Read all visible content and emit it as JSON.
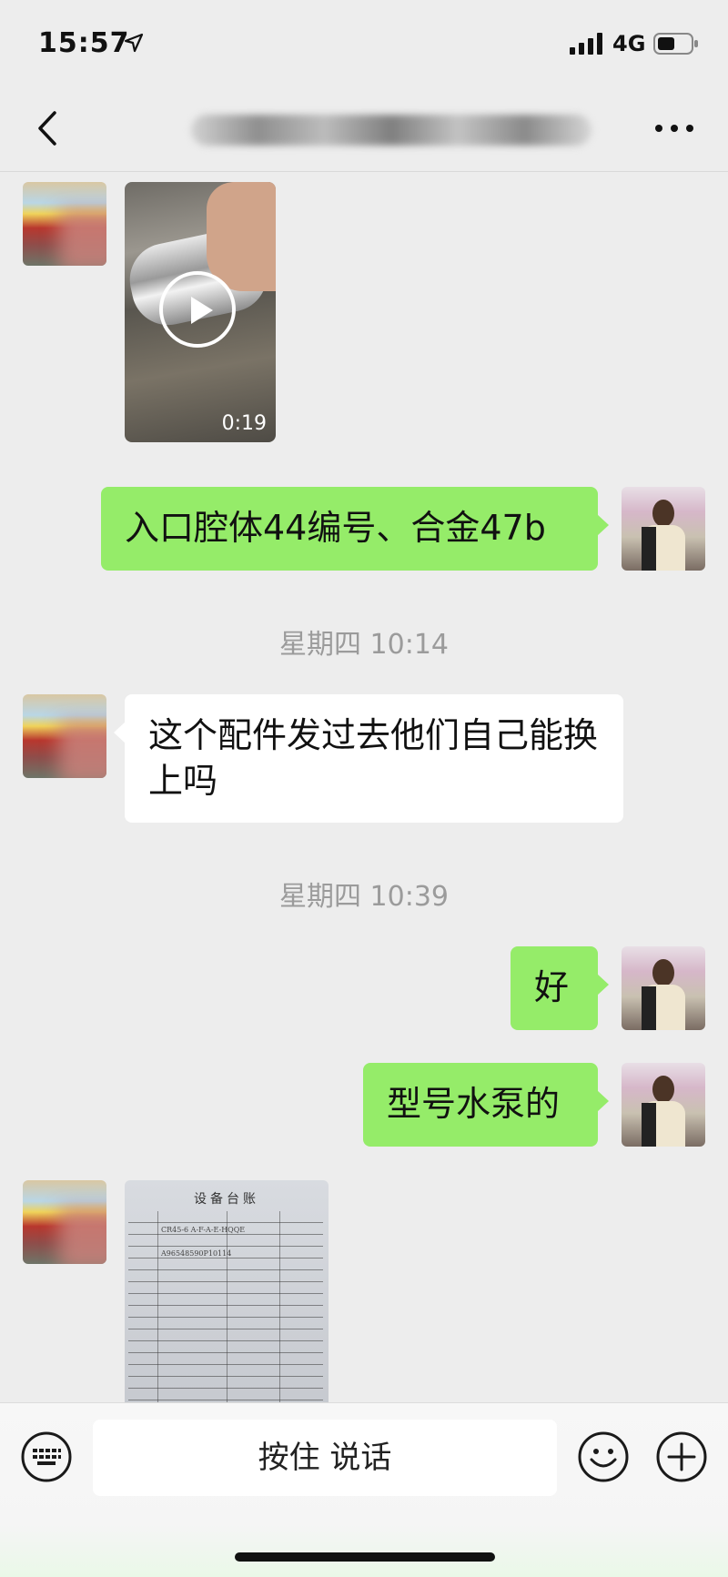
{
  "status": {
    "time": "15:57",
    "network": "4G",
    "icons": [
      "location-arrow-icon",
      "signal-icon",
      "battery-icon"
    ]
  },
  "header": {
    "title": "███████████████████████",
    "back_icon": "chevron-left-icon",
    "more_icon": "more-dots-icon"
  },
  "messages": [
    {
      "type": "video",
      "side": "left",
      "duration": "0:19"
    },
    {
      "type": "text",
      "side": "right",
      "text": "入口腔体44编号、合金47b"
    },
    {
      "type": "time",
      "text": "星期四 10:14"
    },
    {
      "type": "text",
      "side": "left",
      "text": "这个配件发过去他们自己能换上吗"
    },
    {
      "type": "time",
      "text": "星期四 10:39"
    },
    {
      "type": "text",
      "side": "right",
      "text": "好"
    },
    {
      "type": "text",
      "side": "right",
      "text": "型号水泵的"
    },
    {
      "type": "image",
      "side": "left",
      "title": "设备台账",
      "model": "CR45-6 A-F-A-E-HQQE",
      "serial": "A96548590P10114"
    }
  ],
  "input": {
    "voice_label": "按住 说话",
    "icons": [
      "keyboard-icon",
      "emoji-icon",
      "plus-icon"
    ]
  },
  "colors": {
    "outgoing_bubble": "#95ec69",
    "incoming_bubble": "#ffffff",
    "background": "#ededed"
  }
}
